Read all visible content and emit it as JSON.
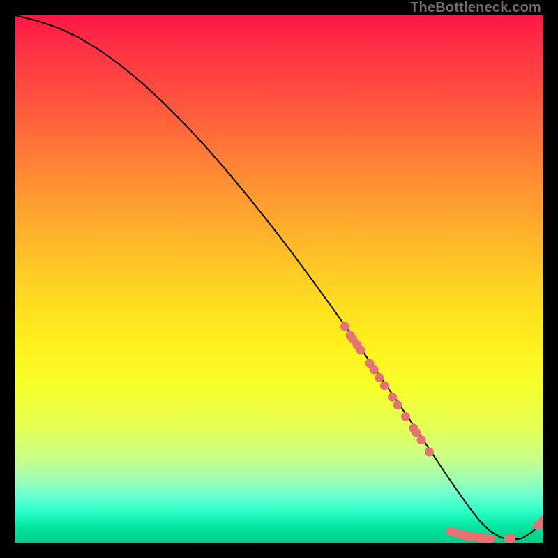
{
  "watermark": "TheBottleneck.com",
  "chart_data": {
    "type": "line",
    "title": "",
    "xlabel": "",
    "ylabel": "",
    "xlim": [
      0,
      100
    ],
    "ylim": [
      0,
      100
    ],
    "series": [
      {
        "name": "bottleneck-curve",
        "x": [
          0,
          4,
          8,
          12,
          16,
          20,
          24,
          28,
          32,
          36,
          40,
          44,
          48,
          52,
          56,
          60,
          64,
          68,
          72,
          76,
          80,
          82,
          84,
          86,
          88,
          90,
          92,
          94,
          96,
          98,
          100
        ],
        "y": [
          100,
          99,
          97.7,
          95.8,
          93.4,
          90.5,
          87.2,
          83.5,
          79.5,
          75.2,
          70.6,
          65.8,
          60.8,
          55.6,
          50.2,
          44.7,
          39.0,
          33.2,
          27.4,
          21.5,
          15.5,
          12.5,
          9.6,
          6.8,
          4.2,
          2.2,
          1.0,
          0.5,
          0.8,
          2.0,
          3.8
        ]
      }
    ],
    "dots": {
      "name": "data-points",
      "color": "#e57373",
      "points": [
        {
          "x": 62.5,
          "y": 41.0
        },
        {
          "x": 63.5,
          "y": 39.3
        },
        {
          "x": 64.0,
          "y": 38.6
        },
        {
          "x": 64.8,
          "y": 37.5
        },
        {
          "x": 65.5,
          "y": 36.5
        },
        {
          "x": 67.2,
          "y": 34.0
        },
        {
          "x": 68.0,
          "y": 32.8
        },
        {
          "x": 69.0,
          "y": 31.3
        },
        {
          "x": 70.0,
          "y": 29.8
        },
        {
          "x": 71.5,
          "y": 27.6
        },
        {
          "x": 72.5,
          "y": 26.1
        },
        {
          "x": 74.0,
          "y": 23.9
        },
        {
          "x": 75.5,
          "y": 21.7
        },
        {
          "x": 76.0,
          "y": 20.9
        },
        {
          "x": 77.0,
          "y": 19.5
        },
        {
          "x": 78.5,
          "y": 17.2
        },
        {
          "x": 82.5,
          "y": 2.1
        },
        {
          "x": 83.2,
          "y": 1.9
        },
        {
          "x": 84.0,
          "y": 1.7
        },
        {
          "x": 84.8,
          "y": 1.5
        },
        {
          "x": 85.5,
          "y": 1.3
        },
        {
          "x": 86.2,
          "y": 1.2
        },
        {
          "x": 87.0,
          "y": 1.1
        },
        {
          "x": 87.8,
          "y": 1.0
        },
        {
          "x": 88.5,
          "y": 0.9
        },
        {
          "x": 89.2,
          "y": 0.8
        },
        {
          "x": 90.0,
          "y": 0.7
        },
        {
          "x": 93.5,
          "y": 0.7
        },
        {
          "x": 94.0,
          "y": 0.8
        },
        {
          "x": 99.0,
          "y": 3.2
        },
        {
          "x": 100.0,
          "y": 4.2
        }
      ]
    }
  }
}
